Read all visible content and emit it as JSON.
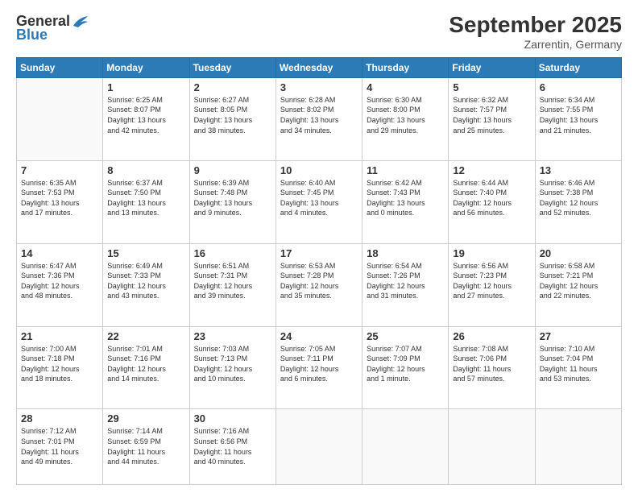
{
  "header": {
    "logo_general": "General",
    "logo_blue": "Blue",
    "month_title": "September 2025",
    "subtitle": "Zarrentin, Germany"
  },
  "days_of_week": [
    "Sunday",
    "Monday",
    "Tuesday",
    "Wednesday",
    "Thursday",
    "Friday",
    "Saturday"
  ],
  "weeks": [
    [
      {
        "day": "",
        "info": ""
      },
      {
        "day": "1",
        "info": "Sunrise: 6:25 AM\nSunset: 8:07 PM\nDaylight: 13 hours\nand 42 minutes."
      },
      {
        "day": "2",
        "info": "Sunrise: 6:27 AM\nSunset: 8:05 PM\nDaylight: 13 hours\nand 38 minutes."
      },
      {
        "day": "3",
        "info": "Sunrise: 6:28 AM\nSunset: 8:02 PM\nDaylight: 13 hours\nand 34 minutes."
      },
      {
        "day": "4",
        "info": "Sunrise: 6:30 AM\nSunset: 8:00 PM\nDaylight: 13 hours\nand 29 minutes."
      },
      {
        "day": "5",
        "info": "Sunrise: 6:32 AM\nSunset: 7:57 PM\nDaylight: 13 hours\nand 25 minutes."
      },
      {
        "day": "6",
        "info": "Sunrise: 6:34 AM\nSunset: 7:55 PM\nDaylight: 13 hours\nand 21 minutes."
      }
    ],
    [
      {
        "day": "7",
        "info": "Sunrise: 6:35 AM\nSunset: 7:53 PM\nDaylight: 13 hours\nand 17 minutes."
      },
      {
        "day": "8",
        "info": "Sunrise: 6:37 AM\nSunset: 7:50 PM\nDaylight: 13 hours\nand 13 minutes."
      },
      {
        "day": "9",
        "info": "Sunrise: 6:39 AM\nSunset: 7:48 PM\nDaylight: 13 hours\nand 9 minutes."
      },
      {
        "day": "10",
        "info": "Sunrise: 6:40 AM\nSunset: 7:45 PM\nDaylight: 13 hours\nand 4 minutes."
      },
      {
        "day": "11",
        "info": "Sunrise: 6:42 AM\nSunset: 7:43 PM\nDaylight: 13 hours\nand 0 minutes."
      },
      {
        "day": "12",
        "info": "Sunrise: 6:44 AM\nSunset: 7:40 PM\nDaylight: 12 hours\nand 56 minutes."
      },
      {
        "day": "13",
        "info": "Sunrise: 6:46 AM\nSunset: 7:38 PM\nDaylight: 12 hours\nand 52 minutes."
      }
    ],
    [
      {
        "day": "14",
        "info": "Sunrise: 6:47 AM\nSunset: 7:36 PM\nDaylight: 12 hours\nand 48 minutes."
      },
      {
        "day": "15",
        "info": "Sunrise: 6:49 AM\nSunset: 7:33 PM\nDaylight: 12 hours\nand 43 minutes."
      },
      {
        "day": "16",
        "info": "Sunrise: 6:51 AM\nSunset: 7:31 PM\nDaylight: 12 hours\nand 39 minutes."
      },
      {
        "day": "17",
        "info": "Sunrise: 6:53 AM\nSunset: 7:28 PM\nDaylight: 12 hours\nand 35 minutes."
      },
      {
        "day": "18",
        "info": "Sunrise: 6:54 AM\nSunset: 7:26 PM\nDaylight: 12 hours\nand 31 minutes."
      },
      {
        "day": "19",
        "info": "Sunrise: 6:56 AM\nSunset: 7:23 PM\nDaylight: 12 hours\nand 27 minutes."
      },
      {
        "day": "20",
        "info": "Sunrise: 6:58 AM\nSunset: 7:21 PM\nDaylight: 12 hours\nand 22 minutes."
      }
    ],
    [
      {
        "day": "21",
        "info": "Sunrise: 7:00 AM\nSunset: 7:18 PM\nDaylight: 12 hours\nand 18 minutes."
      },
      {
        "day": "22",
        "info": "Sunrise: 7:01 AM\nSunset: 7:16 PM\nDaylight: 12 hours\nand 14 minutes."
      },
      {
        "day": "23",
        "info": "Sunrise: 7:03 AM\nSunset: 7:13 PM\nDaylight: 12 hours\nand 10 minutes."
      },
      {
        "day": "24",
        "info": "Sunrise: 7:05 AM\nSunset: 7:11 PM\nDaylight: 12 hours\nand 6 minutes."
      },
      {
        "day": "25",
        "info": "Sunrise: 7:07 AM\nSunset: 7:09 PM\nDaylight: 12 hours\nand 1 minute."
      },
      {
        "day": "26",
        "info": "Sunrise: 7:08 AM\nSunset: 7:06 PM\nDaylight: 11 hours\nand 57 minutes."
      },
      {
        "day": "27",
        "info": "Sunrise: 7:10 AM\nSunset: 7:04 PM\nDaylight: 11 hours\nand 53 minutes."
      }
    ],
    [
      {
        "day": "28",
        "info": "Sunrise: 7:12 AM\nSunset: 7:01 PM\nDaylight: 11 hours\nand 49 minutes."
      },
      {
        "day": "29",
        "info": "Sunrise: 7:14 AM\nSunset: 6:59 PM\nDaylight: 11 hours\nand 44 minutes."
      },
      {
        "day": "30",
        "info": "Sunrise: 7:16 AM\nSunset: 6:56 PM\nDaylight: 11 hours\nand 40 minutes."
      },
      {
        "day": "",
        "info": ""
      },
      {
        "day": "",
        "info": ""
      },
      {
        "day": "",
        "info": ""
      },
      {
        "day": "",
        "info": ""
      }
    ]
  ]
}
